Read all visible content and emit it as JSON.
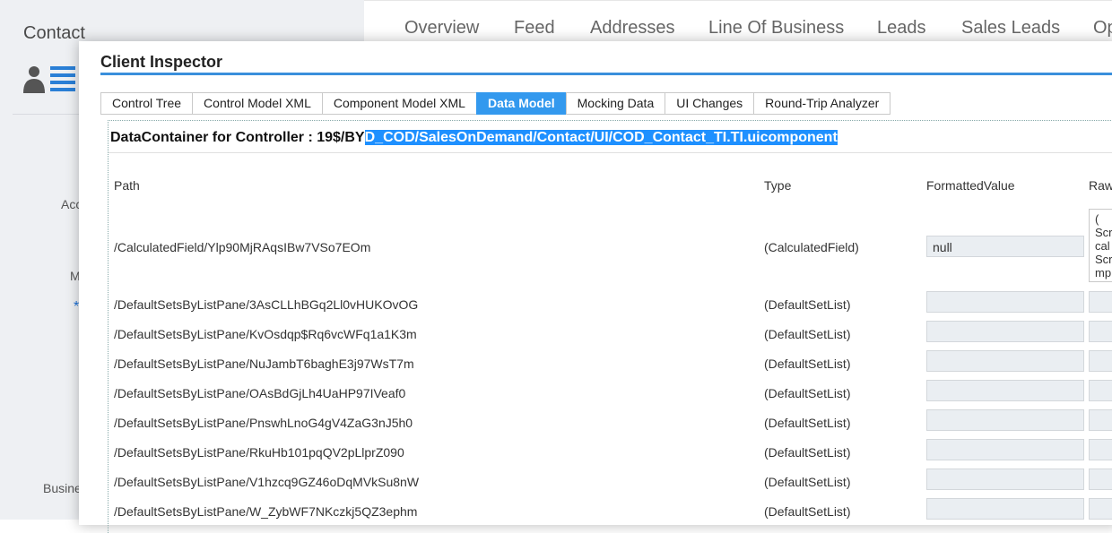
{
  "background": {
    "app_title": "Contact",
    "fragments": {
      "acc": "Acc",
      "m": "M",
      "star": "*",
      "busi": "Busine"
    },
    "tabs": [
      "Overview",
      "Feed",
      "Addresses",
      "Line Of Business",
      "Leads",
      "Sales Leads",
      "Op"
    ]
  },
  "dialog": {
    "title": "Client Inspector",
    "tabs": [
      "Control Tree",
      "Control Model XML",
      "Component Model XML",
      "Data Model",
      "Mocking Data",
      "UI Changes",
      "Round-Trip Analyzer"
    ],
    "active_tab": "Data Model",
    "header_prefix": "DataContainer for Controller : 19$/BY",
    "header_selected": "D_COD/SalesOnDemand/Contact/UI/COD_Contact_TI.TI.uicomponent",
    "columns": {
      "path": "Path",
      "type": "Type",
      "formatted": "FormattedValue",
      "raw": "Raw"
    },
    "rows": [
      {
        "path": "/CalculatedField/Ylp90MjRAqsIBw7VSo7EOm",
        "type": "(CalculatedField)",
        "formatted": "null",
        "raw": "(\nScr\ncal\nScr\nmp"
      },
      {
        "path": "/DefaultSetsByListPane/3AsCLLhBGq2Ll0vHUKOvOG",
        "type": "(DefaultSetList)",
        "formatted": "",
        "raw": ""
      },
      {
        "path": "/DefaultSetsByListPane/KvOsdqp$Rq6vcWFq1a1K3m",
        "type": "(DefaultSetList)",
        "formatted": "",
        "raw": ""
      },
      {
        "path": "/DefaultSetsByListPane/NuJambT6baghE3j97WsT7m",
        "type": "(DefaultSetList)",
        "formatted": "",
        "raw": ""
      },
      {
        "path": "/DefaultSetsByListPane/OAsBdGjLh4UaHP97IVeaf0",
        "type": "(DefaultSetList)",
        "formatted": "",
        "raw": ""
      },
      {
        "path": "/DefaultSetsByListPane/PnswhLnoG4gV4ZaG3nJ5h0",
        "type": "(DefaultSetList)",
        "formatted": "",
        "raw": ""
      },
      {
        "path": "/DefaultSetsByListPane/RkuHb101pqQV2pLlprZ090",
        "type": "(DefaultSetList)",
        "formatted": "",
        "raw": ""
      },
      {
        "path": "/DefaultSetsByListPane/V1hzcq9GZ46oDqMVkSu8nW",
        "type": "(DefaultSetList)",
        "formatted": "",
        "raw": ""
      },
      {
        "path": "/DefaultSetsByListPane/W_ZybWF7NKczkj5QZ3ephm",
        "type": "(DefaultSetList)",
        "formatted": "",
        "raw": ""
      }
    ]
  },
  "colors": {
    "accent": "#3399ee",
    "selection": "#1e90ff",
    "field_bg": "#eaeef2"
  }
}
